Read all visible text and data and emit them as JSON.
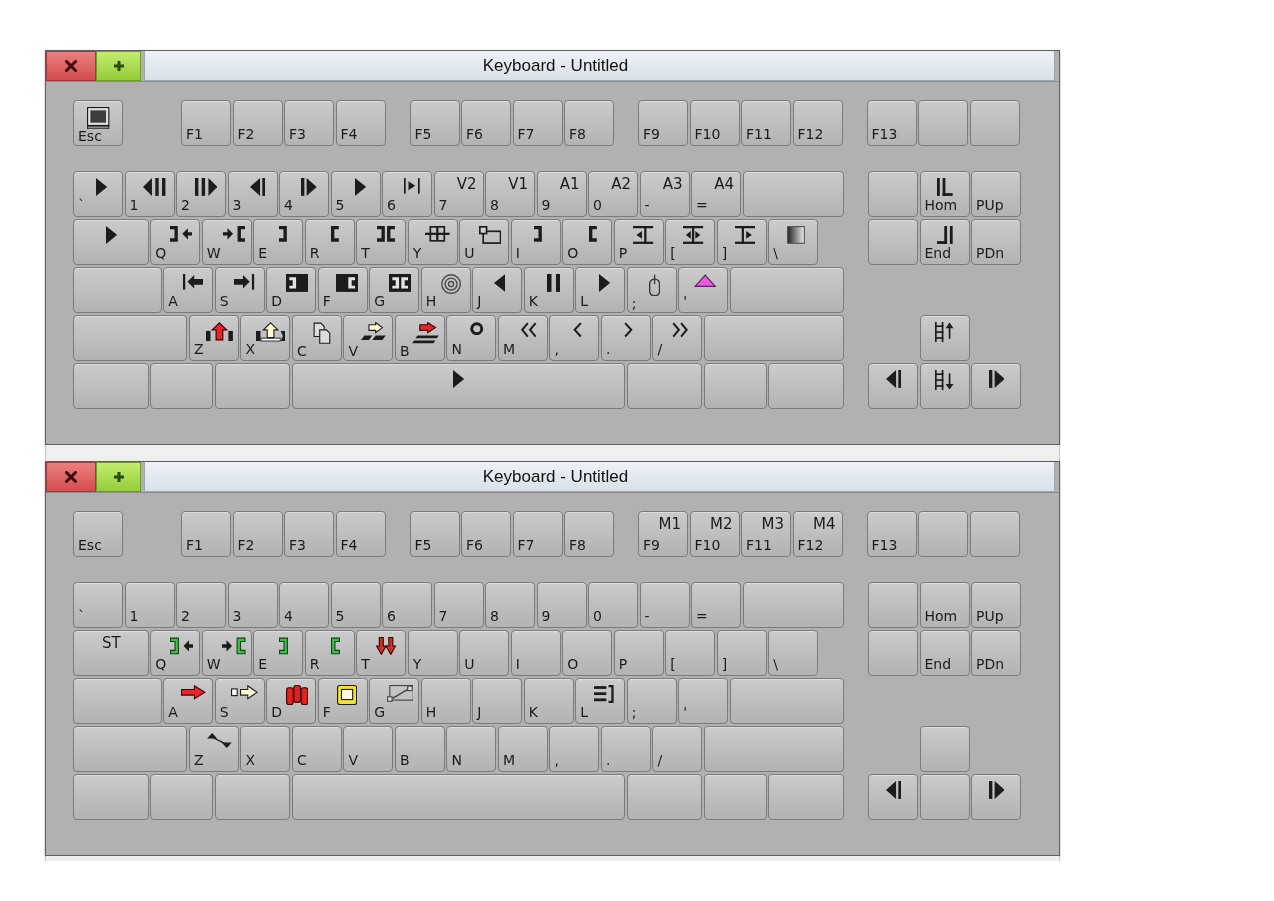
{
  "keyboards": [
    {
      "title": "Keyboard - Untitled",
      "function_keys": [
        {
          "label": "Esc"
        },
        {
          "label": "F1"
        },
        {
          "label": "F2"
        },
        {
          "label": "F3"
        },
        {
          "label": "F4"
        },
        {
          "label": "F5"
        },
        {
          "label": "F6"
        },
        {
          "label": "F7"
        },
        {
          "label": "F8"
        },
        {
          "label": "F9"
        },
        {
          "label": "F10"
        },
        {
          "label": "F11"
        },
        {
          "label": "F12"
        },
        {
          "label": "F13"
        }
      ],
      "number_row": [
        {
          "label": "`"
        },
        {
          "label": "1"
        },
        {
          "label": "2"
        },
        {
          "label": "3"
        },
        {
          "label": "4"
        },
        {
          "label": "5"
        },
        {
          "label": "6"
        },
        {
          "label": "7",
          "command": "V2"
        },
        {
          "label": "8",
          "command": "V1"
        },
        {
          "label": "9",
          "command": "A1"
        },
        {
          "label": "0",
          "command": "A2"
        },
        {
          "label": "-",
          "command": "A3"
        },
        {
          "label": "=",
          "command": "A4"
        }
      ],
      "top_row": [
        {
          "label": "Q"
        },
        {
          "label": "W"
        },
        {
          "label": "E"
        },
        {
          "label": "R"
        },
        {
          "label": "T"
        },
        {
          "label": "Y"
        },
        {
          "label": "U"
        },
        {
          "label": "I"
        },
        {
          "label": "O"
        },
        {
          "label": "P"
        },
        {
          "label": "["
        },
        {
          "label": "]"
        },
        {
          "label": "\\"
        }
      ],
      "home_row": [
        {
          "label": "A"
        },
        {
          "label": "S"
        },
        {
          "label": "D"
        },
        {
          "label": "F"
        },
        {
          "label": "G"
        },
        {
          "label": "H"
        },
        {
          "label": "J"
        },
        {
          "label": "K"
        },
        {
          "label": "L"
        },
        {
          "label": ";"
        },
        {
          "label": "'"
        }
      ],
      "bottom_row": [
        {
          "label": "Z"
        },
        {
          "label": "X"
        },
        {
          "label": "C"
        },
        {
          "label": "V"
        },
        {
          "label": "B"
        },
        {
          "label": "N"
        },
        {
          "label": "M"
        },
        {
          "label": ","
        },
        {
          "label": "."
        },
        {
          "label": "/"
        }
      ],
      "nav_keys": [
        {
          "label": "Hom"
        },
        {
          "label": "PUp"
        },
        {
          "label": "End"
        },
        {
          "label": "PDn"
        }
      ]
    },
    {
      "title": "Keyboard - Untitled",
      "function_keys": [
        {
          "label": "Esc"
        },
        {
          "label": "F1"
        },
        {
          "label": "F2"
        },
        {
          "label": "F3"
        },
        {
          "label": "F4"
        },
        {
          "label": "F5"
        },
        {
          "label": "F6"
        },
        {
          "label": "F7"
        },
        {
          "label": "F8"
        },
        {
          "label": "F9",
          "command": "M1"
        },
        {
          "label": "F10",
          "command": "M2"
        },
        {
          "label": "F11",
          "command": "M3"
        },
        {
          "label": "F12",
          "command": "M4"
        },
        {
          "label": "F13"
        }
      ],
      "number_row": [
        {
          "label": "`"
        },
        {
          "label": "1"
        },
        {
          "label": "2"
        },
        {
          "label": "3"
        },
        {
          "label": "4"
        },
        {
          "label": "5"
        },
        {
          "label": "6"
        },
        {
          "label": "7"
        },
        {
          "label": "8"
        },
        {
          "label": "9"
        },
        {
          "label": "0"
        },
        {
          "label": "-"
        },
        {
          "label": "="
        }
      ],
      "tab_key": {
        "command": "ST"
      },
      "top_row": [
        {
          "label": "Q"
        },
        {
          "label": "W"
        },
        {
          "label": "E"
        },
        {
          "label": "R"
        },
        {
          "label": "T"
        },
        {
          "label": "Y"
        },
        {
          "label": "U"
        },
        {
          "label": "I"
        },
        {
          "label": "O"
        },
        {
          "label": "P"
        },
        {
          "label": "["
        },
        {
          "label": "]"
        },
        {
          "label": "\\"
        }
      ],
      "home_row": [
        {
          "label": "A"
        },
        {
          "label": "S"
        },
        {
          "label": "D"
        },
        {
          "label": "F"
        },
        {
          "label": "G"
        },
        {
          "label": "H"
        },
        {
          "label": "J"
        },
        {
          "label": "K"
        },
        {
          "label": "L"
        },
        {
          "label": ";"
        },
        {
          "label": "'"
        }
      ],
      "bottom_row": [
        {
          "label": "Z"
        },
        {
          "label": "X"
        },
        {
          "label": "C"
        },
        {
          "label": "V"
        },
        {
          "label": "B"
        },
        {
          "label": "N"
        },
        {
          "label": "M"
        },
        {
          "label": ","
        },
        {
          "label": "."
        },
        {
          "label": "/"
        }
      ],
      "nav_keys": [
        {
          "label": "Hom"
        },
        {
          "label": "PUp"
        },
        {
          "label": "End"
        },
        {
          "label": "PDn"
        }
      ]
    }
  ]
}
